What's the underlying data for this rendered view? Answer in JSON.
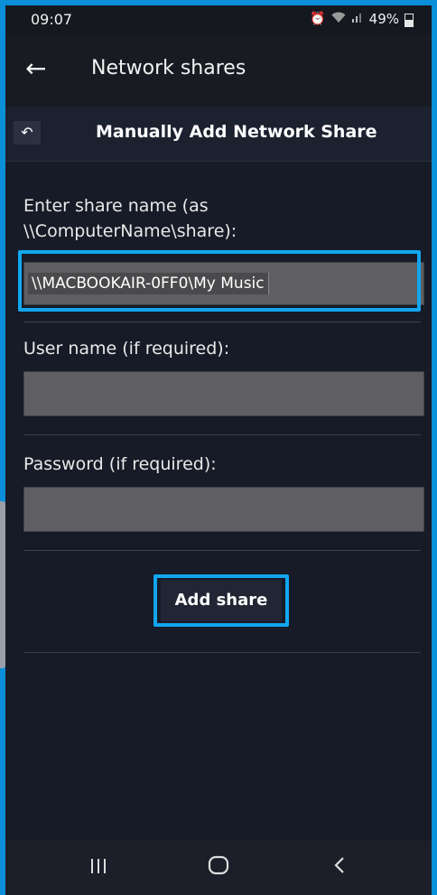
{
  "status_bar": {
    "time": "09:07",
    "battery": "49%",
    "icons": [
      "alarm-icon",
      "wifi-icon",
      "signal-icon",
      "battery-icon"
    ]
  },
  "app_bar": {
    "back_icon": "arrow-left-icon",
    "title": "Network shares"
  },
  "sub_header": {
    "undo_icon": "undo-icon",
    "title": "Manually Add Network Share"
  },
  "form": {
    "share_label": "Enter share name (as \\\\ComputerName\\share):",
    "share_value": "\\\\MACBOOKAIR-0FF0\\My Music",
    "user_label": "User name (if required):",
    "user_value": "",
    "password_label": "Password (if required):",
    "password_value": "",
    "submit_label": "Add share"
  },
  "nav_bar": {
    "recents_icon": "recents-icon",
    "home_icon": "home-icon",
    "back_icon": "back-icon"
  },
  "colors": {
    "highlight": "#12a6ef",
    "background": "#171b27",
    "field": "#5f5f62"
  }
}
